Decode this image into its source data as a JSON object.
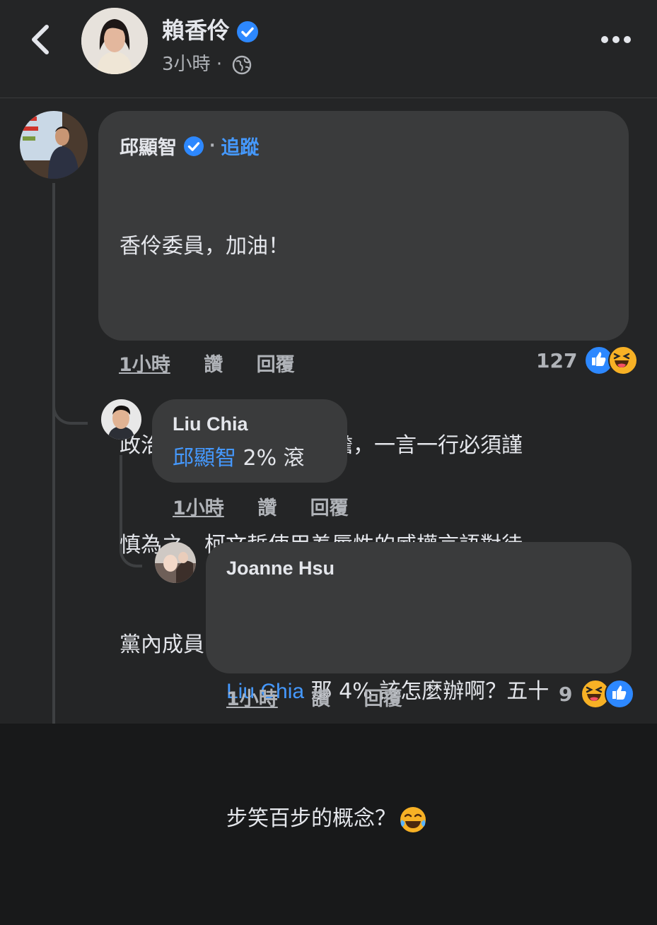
{
  "post": {
    "author": "賴香伶",
    "time": "3小時",
    "separator": "·"
  },
  "comments": [
    {
      "author": "邱顯智",
      "follow_label": "追蹤",
      "separator": "·",
      "lines": [
        "香伶委員，加油！",
        "",
        "政治人物的言行動見觀瞻，一言一行必須謹",
        "慎為之。柯文哲使用羞辱性的威權言語對待",
        "黨內成員，毫無疑問是反民主的最壞示範！"
      ],
      "time": "1小時",
      "like_label": "讚",
      "reply_label": "回覆",
      "reaction_count": "127",
      "reaction_icons": [
        "like-icon",
        "haha-icon"
      ]
    },
    {
      "author": "Liu Chia",
      "mention": "邱顯智",
      "text": " 2% 滾",
      "time": "1小時",
      "like_label": "讚",
      "reply_label": "回覆"
    },
    {
      "author": "Joanne Hsu",
      "mention": "Liu Chia",
      "text_line1": " 那 4% 該怎麼辦啊？五十",
      "text_line2": "步笑百步的概念？",
      "emoji": "😂",
      "time": "1小時",
      "like_label": "讚",
      "reply_label": "回覆",
      "reaction_count": "9",
      "reaction_icons": [
        "haha-icon",
        "like-icon"
      ]
    }
  ],
  "colors": {
    "background": "#242526",
    "bubble": "#3a3b3c",
    "link": "#4599ff",
    "verified": "#2d88ff"
  }
}
